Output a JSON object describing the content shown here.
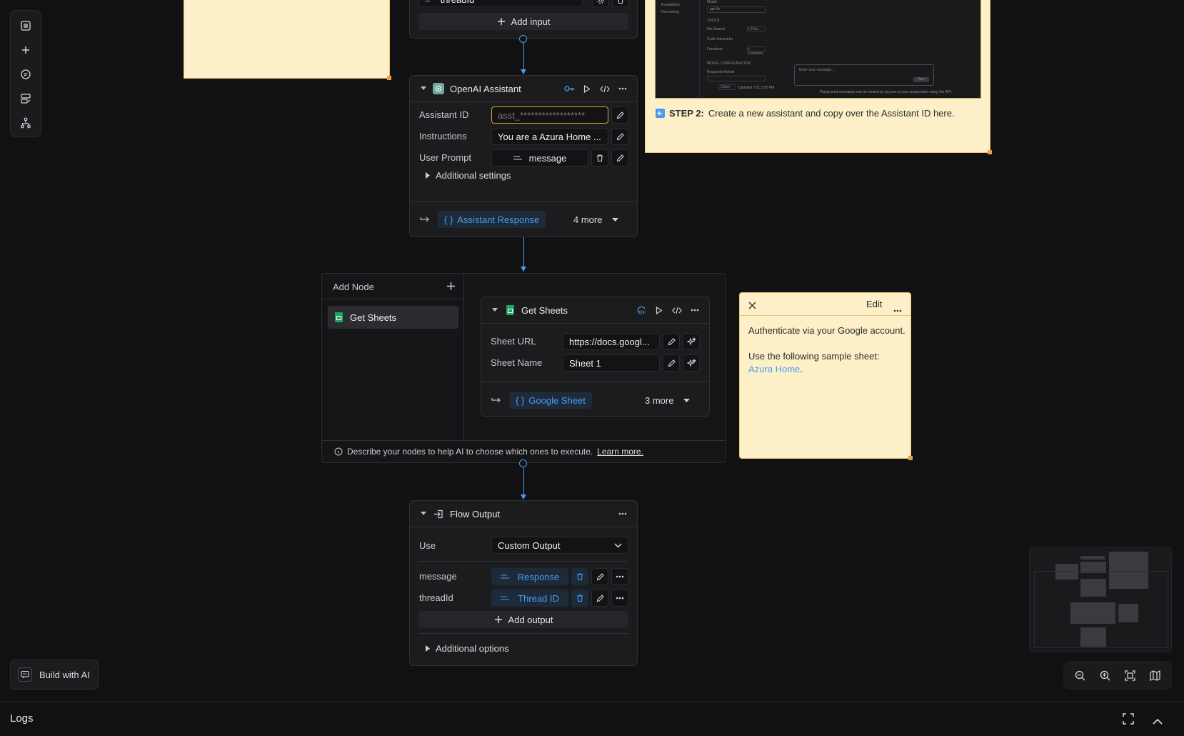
{
  "toolbar": {
    "items": [
      {
        "name": "menu-icon"
      },
      {
        "name": "plus-icon"
      },
      {
        "name": "comment-icon"
      },
      {
        "name": "form-icon"
      },
      {
        "name": "hierarchy-icon"
      }
    ]
  },
  "top_node": {
    "input_name": "threadId",
    "add_input_label": "Add input"
  },
  "note_step2": {
    "step_label": "STEP 2:",
    "text": "Create a new assistant and copy over the Assistant ID here.",
    "screenshot": {
      "sidebar": [
        "Evaluations",
        "Fine-tuning"
      ],
      "model_label": "Model",
      "model_value": "gpt-4o",
      "tools_label": "TOOLS",
      "file_search": "File Search",
      "code_interpreter": "Code Interpreter",
      "functions_label": "Functions",
      "add_label": "+ Files",
      "add_function": "+ Functions",
      "model_config": "MODEL CONFIGURATION",
      "response_format": "Response format",
      "clone": "Clone",
      "updated": "Updated 7/31 3:02 PM",
      "message_placeholder": "Enter your message...",
      "run": "Run",
      "footer": "Playground messages can be viewed by anyone at your organization using the API."
    }
  },
  "openai_node": {
    "title": "OpenAI Assistant",
    "fields": {
      "assistant_id_label": "Assistant ID",
      "assistant_id_placeholder": "asst_******************",
      "instructions_label": "Instructions",
      "instructions_value": "You are a Azura Home ...",
      "user_prompt_label": "User Prompt",
      "user_prompt_value": "message"
    },
    "additional_settings": "Additional settings",
    "output_chip": "Assistant Response",
    "more_label": "4 more"
  },
  "add_node_panel": {
    "title": "Add Node",
    "items": [
      {
        "label": "Get Sheets"
      }
    ],
    "hint": "Describe your nodes to help AI to choose which ones to execute.",
    "learn_more": "Learn more."
  },
  "sheets_node": {
    "title": "Get Sheets",
    "sheet_url_label": "Sheet URL",
    "sheet_url_value": "https://docs.googl...",
    "sheet_name_label": "Sheet Name",
    "sheet_name_value": "Sheet 1",
    "output_chip": "Google Sheet",
    "more_label": "3 more"
  },
  "note_google": {
    "edit_label": "Edit",
    "line1": "Authenticate via your Google account.",
    "line2": "Use the following sample sheet:",
    "link": "Azura Home",
    "period": "."
  },
  "flow_output_node": {
    "title": "Flow Output",
    "use_label": "Use",
    "use_value": "Custom Output",
    "outputs": [
      {
        "name": "message",
        "value": "Response"
      },
      {
        "name": "threadId",
        "value": "Thread ID"
      }
    ],
    "add_output_label": "Add output",
    "additional_options": "Additional options"
  },
  "build_ai": {
    "label": "Build with AI"
  },
  "logs": {
    "label": "Logs"
  },
  "colors": {
    "accent": "#4a9cf0",
    "note_bg": "#fdf0c8",
    "canvas_bg": "#111113",
    "google_sheets_green": "#1fa463",
    "openai_green": "#74aa9c"
  }
}
